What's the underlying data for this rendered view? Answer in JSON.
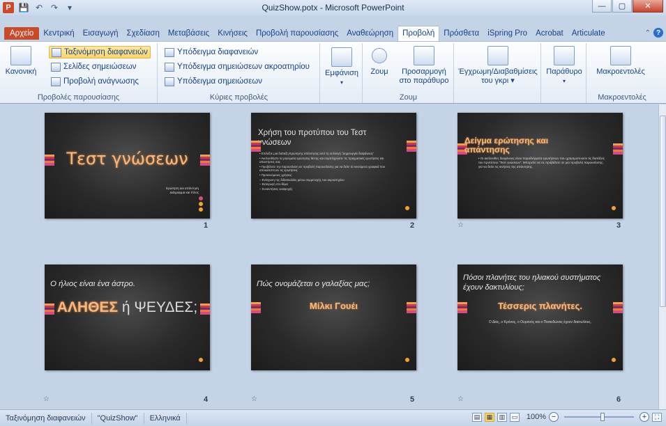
{
  "window": {
    "title": "QuizShow.potx - Microsoft PowerPoint",
    "minimize": "—",
    "maximize": "▢",
    "close": "✕"
  },
  "qat": {
    "save": "💾",
    "undo": "↶",
    "redo": "↷",
    "customize": "▾"
  },
  "tabs": {
    "file": "Αρχείο",
    "items": [
      "Κεντρική",
      "Εισαγωγή",
      "Σχεδίαση",
      "Μεταβάσεις",
      "Κινήσεις",
      "Προβολή παρουσίασης",
      "Αναθεώρηση",
      "Προβολή",
      "Πρόσθετα",
      "iSpring Pro",
      "Acrobat",
      "Articulate"
    ],
    "help": "?"
  },
  "ribbon": {
    "presentation_views": {
      "label": "Προβολές παρουσίασης",
      "normal": "Κανονική",
      "slide_sorter": "Ταξινόμηση διαφανειών",
      "notes_page": "Σελίδες σημειώσεων",
      "reading_view": "Προβολή ανάγνωσης"
    },
    "master_views": {
      "label": "Κύριες προβολές",
      "slide_master": "Υπόδειγμα διαφανειών",
      "handout_master": "Υπόδειγμα σημειώσεων ακροατηρίου",
      "notes_master": "Υπόδειγμα σημειώσεων"
    },
    "show": {
      "label": "Εμφάνιση"
    },
    "zoom": {
      "label": "Ζουμ",
      "zoom": "Ζουμ",
      "fit_line1": "Προσαρμογή",
      "fit_line2": "στο παράθυρο"
    },
    "color": {
      "line1": "Έγχρωμη/Διαβαθμίσεις",
      "line2": "του γκρι"
    },
    "window": {
      "label": "Παράθυρο"
    },
    "macros": {
      "label": "Μακροεντολές",
      "button": "Μακροεντολές"
    }
  },
  "slides": [
    {
      "number": "1",
      "title": "Τεστ γνώσεων",
      "subtitle_line1": "Ερώτηση και απάντηση",
      "subtitle_line2": "Διάγραμμα και τίτλος"
    },
    {
      "number": "2",
      "title": "Χρήση του προτύπου του Τεστ γνώσεων",
      "bullets": [
        "• Επιλέξτε μια διάταξη Ερώτησης απάντησης από τη συλλογή \"Δημιουργία διαφάνειας\"",
        "• Ακολουθήστε τα μηνύματα ερώτησης θέσης και συμπληρώστε τις πραγματικές ερωτήσεις και απαντήσεις σας",
        "• Προβάλετε την παρουσίαση σε προβολή παρουσίασης για να δείτε τα κινούμενα γραφικά που αποκαλύπτουν τις ερωτήσεις",
        "• Προτεινόμενες χρήσεις:",
        "   – Ενίσχυση της διδασκαλίας μέσω συμμετοχής του ακροατηρίου",
        "   – Εισαγωγή στο θέμα",
        "   – Συναντήσεις αναψυχής"
      ]
    },
    {
      "number": "3",
      "title": "Δείγμα ερώτησης και απάντησης",
      "body": "• Οι ακόλουθες διαφάνειες είναι παραδείγματα ερωτήσεων που χρησιμοποιούν τις διατάξεις του προτύπου \"Τεστ γνώσεων\". Μπορείτε να τις προβάλετε σε μια προβολή παρουσίασης, για να δείτε τις κινήσεις της απάντησης."
    },
    {
      "number": "4",
      "question": "Ο ήλιος είναι ένα άστρο.",
      "answer_true": "ΑΛΗΘΕΣ",
      "answer_rest": " ή ΨΕΥΔΕΣ;"
    },
    {
      "number": "5",
      "question": "Πώς ονομάζεται ο γαλαξίας μας;",
      "answer": "Μίλκι Γουέι"
    },
    {
      "number": "6",
      "question": "Πόσοι πλανήτες του ηλιακού συστήματος έχουν δακτυλίους;",
      "answer": "Τέσσερις πλανήτες.",
      "note": "Ο Δίας, ο Κρόνος, ο Ουρανός και ο Ποσειδώνας έχουν δακτυλίους."
    }
  ],
  "transition_icon": "☆",
  "statusbar": {
    "view": "Ταξινόμηση διαφανειών",
    "theme": "\"QuizShow\"",
    "language": "Ελληνικά",
    "zoom": "100%",
    "zoom_out": "−",
    "zoom_in": "+"
  }
}
